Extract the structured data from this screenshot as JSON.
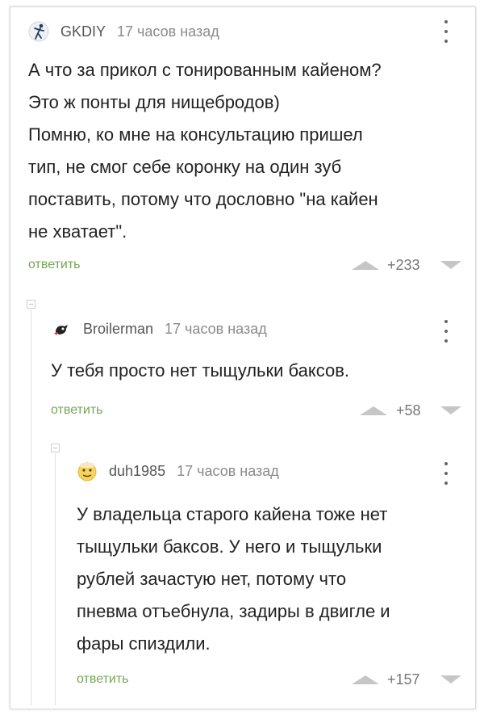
{
  "comments": [
    {
      "username": "GKDIY",
      "time": "17 часов назад",
      "avatar_icon": "stick-figure-avatar-icon",
      "lines": [
        "А что за прикол с тонированным кайеном?",
        "Это ж понты для нищебродов)",
        "Помню, ко мне на консультацию пришел",
        "тип, не смог себе коронку на один зуб",
        "поставить, потому что дословно \"на кайен",
        "не хватает\"."
      ],
      "reply_label": "ответить",
      "rating": "+233"
    },
    {
      "username": "Broilerman",
      "time": "17 часов назад",
      "avatar_icon": "bird-avatar-icon",
      "lines": [
        "У тебя просто нет тыщульки баксов."
      ],
      "reply_label": "ответить",
      "rating": "+58"
    },
    {
      "username": "duh1985",
      "time": "17 часов назад",
      "avatar_icon": "emoji-face-avatar-icon",
      "lines": [
        "У владельца старого кайена тоже нет",
        "тыщульки баксов. У него и тыщульки",
        "рублей зачастую нет, потому что",
        "пневма отъебнула, задиры в двигле и",
        "фары спиздили."
      ],
      "reply_label": "ответить",
      "rating": "+157"
    }
  ],
  "colors": {
    "reply_link": "#76a655",
    "vote_arrow": "#c6c6c6",
    "username": "#555555",
    "time": "#8a8a8a"
  }
}
